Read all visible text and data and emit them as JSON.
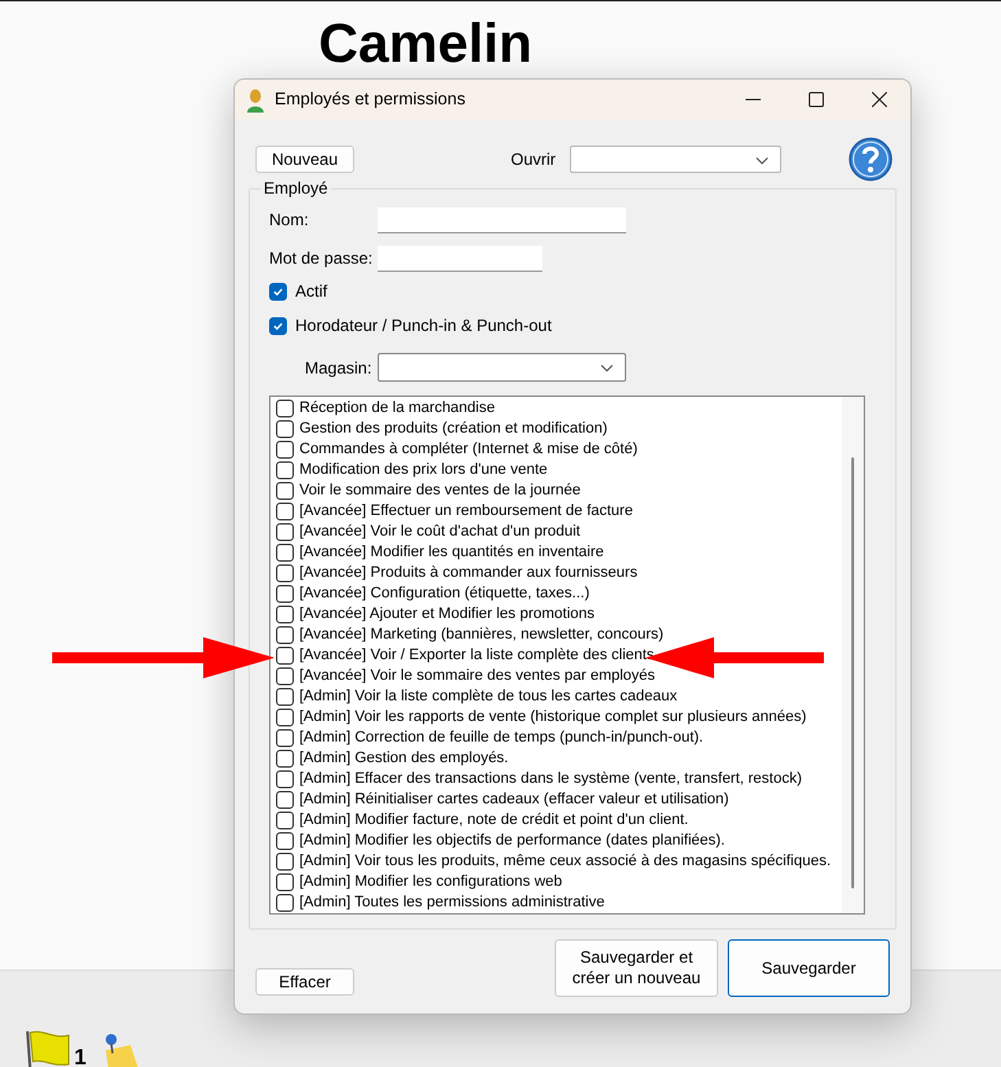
{
  "page": {
    "heading": "Camelin",
    "taskbar_count": "1"
  },
  "window": {
    "title": "Employés et permissions"
  },
  "toolbar": {
    "new_button": "Nouveau",
    "open_label": "Ouvrir"
  },
  "employee": {
    "legend": "Employé",
    "name_label": "Nom:",
    "password_label": "Mot de passe:",
    "checkboxes": [
      {
        "label": "Actif",
        "checked": true
      },
      {
        "label": "Horodateur / Punch-in & Punch-out",
        "checked": true
      }
    ],
    "store_label": "Magasin:"
  },
  "permissions": [
    {
      "label": "Réception de la marchandise",
      "checked": false
    },
    {
      "label": "Gestion des produits (création et modification)",
      "checked": false
    },
    {
      "label": "Commandes à compléter (Internet & mise de côté)",
      "checked": false
    },
    {
      "label": "Modification des prix lors d'une vente",
      "checked": false
    },
    {
      "label": "Voir le sommaire des ventes de la journée",
      "checked": false
    },
    {
      "label": "[Avancée] Effectuer un remboursement de facture",
      "checked": false
    },
    {
      "label": "[Avancée] Voir le coût d'achat d'un produit",
      "checked": false
    },
    {
      "label": "[Avancée] Modifier les quantités en inventaire",
      "checked": false
    },
    {
      "label": "[Avancée] Produits à commander aux fournisseurs",
      "checked": false
    },
    {
      "label": "[Avancée] Configuration (étiquette, taxes...)",
      "checked": false
    },
    {
      "label": "[Avancée] Ajouter et Modifier les promotions",
      "checked": false
    },
    {
      "label": "[Avancée] Marketing (bannières, newsletter, concours)",
      "checked": false
    },
    {
      "label": "[Avancée] Voir / Exporter la liste complète des clients",
      "checked": false
    },
    {
      "label": "[Avancée] Voir le sommaire des ventes par employés",
      "checked": false
    },
    {
      "label": "[Admin] Voir la liste complète de tous les cartes cadeaux",
      "checked": false
    },
    {
      "label": "[Admin] Voir les rapports de vente (historique complet sur plusieurs années)",
      "checked": false
    },
    {
      "label": "[Admin] Correction de feuille de temps (punch-in/punch-out).",
      "checked": false
    },
    {
      "label": "[Admin] Gestion des employés.",
      "checked": false
    },
    {
      "label": "[Admin] Effacer des transactions dans le système (vente, transfert, restock)",
      "checked": false
    },
    {
      "label": "[Admin] Réinitialiser cartes cadeaux (effacer valeur et utilisation)",
      "checked": false
    },
    {
      "label": "[Admin] Modifier facture, note de crédit et point d'un client.",
      "checked": false
    },
    {
      "label": "[Admin] Modifier les objectifs de performance (dates planifiées).",
      "checked": false
    },
    {
      "label": "[Admin] Voir tous les produits, même ceux associé à des magasins spécifiques.",
      "checked": false
    },
    {
      "label": "[Admin] Modifier les configurations web",
      "checked": false
    },
    {
      "label": "[Admin] Toutes les permissions administrative",
      "checked": false
    }
  ],
  "footer": {
    "clear_button": "Effacer",
    "save_new_button": "Sauvegarder et\ncréer un nouveau",
    "save_button": "Sauvegarder"
  }
}
